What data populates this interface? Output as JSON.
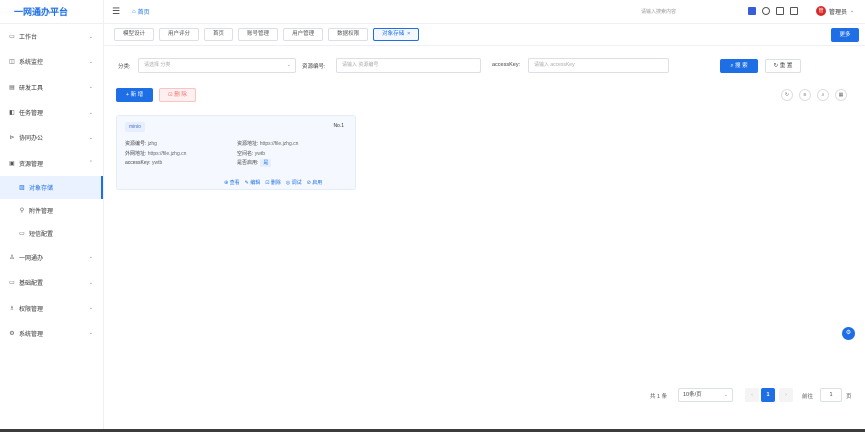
{
  "app": {
    "title": "一网通办平台"
  },
  "sidebar": {
    "items": [
      {
        "label": "工作台",
        "icon": "monitor-icon",
        "glyph": "▭",
        "expanded": false
      },
      {
        "label": "系统监控",
        "icon": "chart-icon",
        "glyph": "◫",
        "expanded": false
      },
      {
        "label": "研发工具",
        "icon": "tool-icon",
        "glyph": "▤",
        "expanded": false
      },
      {
        "label": "任务管理",
        "icon": "task-icon",
        "glyph": "◧",
        "expanded": false
      },
      {
        "label": "协同办公",
        "icon": "flow-icon",
        "glyph": "⊳",
        "expanded": false
      },
      {
        "label": "资源管理",
        "icon": "resource-icon",
        "glyph": "▣",
        "expanded": true
      }
    ],
    "sub_items": [
      {
        "label": "对象存储",
        "icon": "storage-icon",
        "glyph": "▨",
        "active": true
      },
      {
        "label": "附件管理",
        "icon": "attachment-icon",
        "glyph": "⚲",
        "active": false
      },
      {
        "label": "短信配置",
        "icon": "sms-icon",
        "glyph": "▭",
        "active": false
      }
    ],
    "items_after": [
      {
        "label": "一网通办",
        "icon": "user-group-icon",
        "glyph": "♙",
        "expanded": false
      },
      {
        "label": "基础配置",
        "icon": "config-icon",
        "glyph": "▭",
        "expanded": false
      },
      {
        "label": "权限管理",
        "icon": "permission-icon",
        "glyph": "♗",
        "expanded": false
      },
      {
        "label": "系统管理",
        "icon": "gear-icon",
        "glyph": "⚙",
        "expanded": false
      }
    ]
  },
  "header": {
    "breadcrumb_home": "首页",
    "search_hint": "请输入搜索内容",
    "user_name": "管理员",
    "user_avatar_text": "管"
  },
  "tabs": [
    {
      "label": "模型设计",
      "active": false
    },
    {
      "label": "用户评分",
      "active": false
    },
    {
      "label": "首页",
      "active": false
    },
    {
      "label": "账号管理",
      "active": false
    },
    {
      "label": "用户管理",
      "active": false
    },
    {
      "label": "数据权限",
      "active": false
    },
    {
      "label": "对象存储",
      "active": true,
      "close": "×"
    }
  ],
  "more_button": "更多",
  "filter": {
    "category_label": "分类:",
    "category_placeholder": "请选择 分类",
    "resource_code_label": "资源编号:",
    "resource_code_placeholder": "请输入 资源编号",
    "accesskey_label": "accessKey:",
    "accesskey_placeholder": "请输入 accessKey",
    "search_button": "搜 索",
    "reset_button": "重 置"
  },
  "actions": {
    "add_button": "新 增",
    "delete_button": "删 除"
  },
  "card": {
    "tag": "minio",
    "number": "No.1",
    "resource_code_label": "资源编号:",
    "resource_code_value": "jzhg",
    "external_url_label": "外网地址:",
    "external_url_value": "https://file.jzhg.cn",
    "accesskey_label": "accessKey:",
    "accesskey_value": "ywtb",
    "resource_url_label": "资源地址:",
    "resource_url_value": "https://file.jzhg.cn",
    "bucket_label": "空间名:",
    "bucket_value": "ywtb",
    "enabled_label": "是否启用:",
    "enabled_value": "是",
    "actions": [
      {
        "label": "查看",
        "icon": "eye-icon",
        "glyph": "⊕"
      },
      {
        "label": "编辑",
        "icon": "edit-icon",
        "glyph": "✎"
      },
      {
        "label": "删除",
        "icon": "trash-icon",
        "glyph": "⊡"
      },
      {
        "label": "调试",
        "icon": "debug-icon",
        "glyph": "◎"
      },
      {
        "label": "启用",
        "icon": "enable-icon",
        "glyph": "⊘"
      }
    ]
  },
  "pagination": {
    "total": "共 1 条",
    "page_size": "10条/页",
    "current_page": "1",
    "goto_label": "前往",
    "goto_value": "1",
    "page_unit": "页"
  },
  "colors": {
    "primary": "#1e6fe6",
    "danger": "#f56c6c",
    "card_bg": "#f5f9ff"
  }
}
